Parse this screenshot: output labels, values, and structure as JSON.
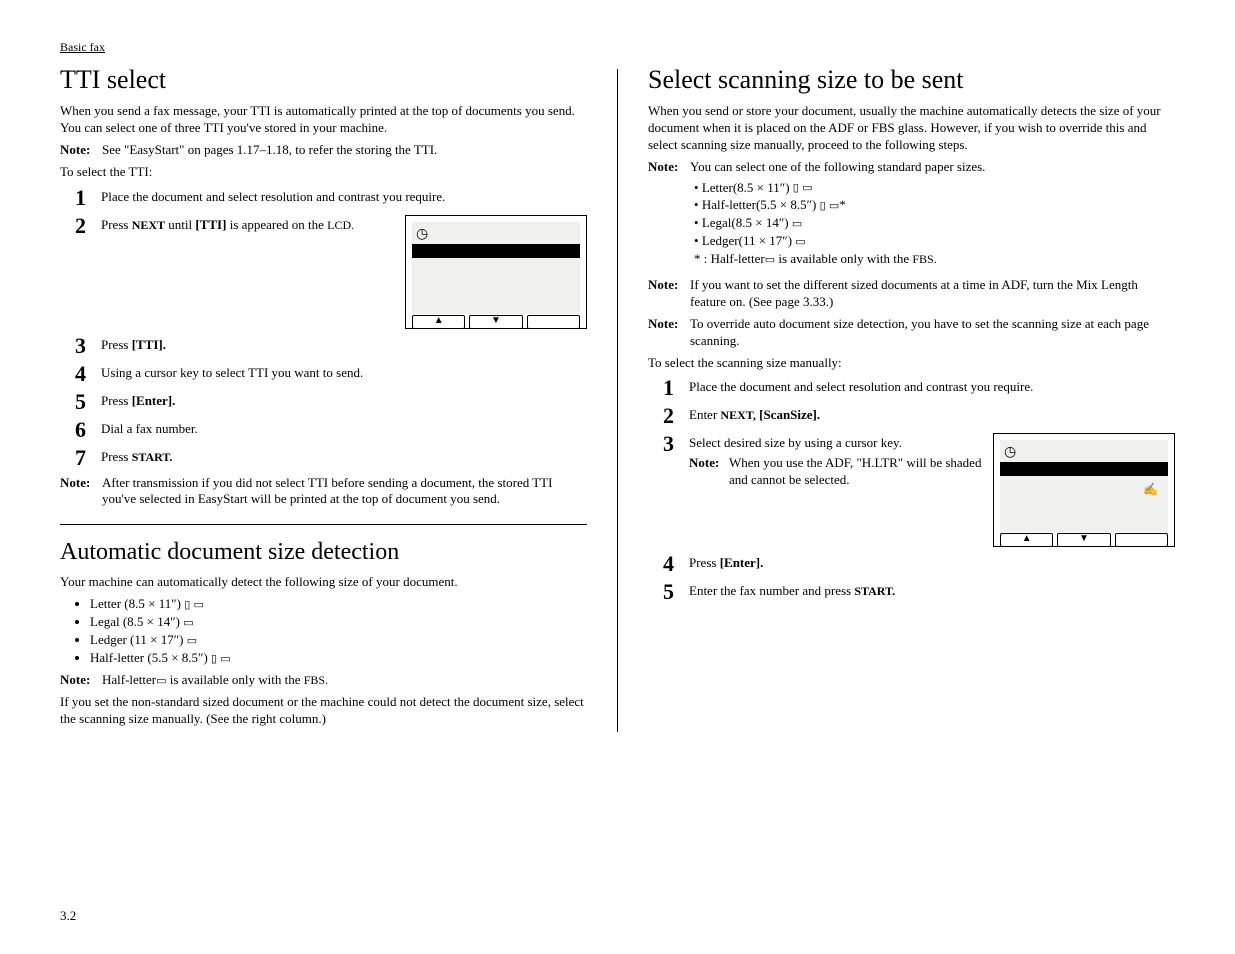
{
  "header": {
    "breadcrumb": "Basic fax"
  },
  "left": {
    "tti": {
      "title": "TTI select",
      "intro": "When you send a fax message, your TTI is automatically printed at the top of documents you send. You can select one of three TTI you've stored in your machine.",
      "note_storing_pre": "See \"EasyStart\" on pages 1.17–1.18, to refer the storing the TTI.",
      "lead": "To select the TTI:",
      "steps": {
        "s1": "Place the document and select resolution and contrast you require.",
        "s2a": "Press ",
        "s2b": " until ",
        "s2c": " is appeared on the ",
        "s3a": "Press ",
        "s4": "Using a cursor key to select TTI you want to send.",
        "s5a": "Press ",
        "s6": "Dial a fax number.",
        "s7a": "Press "
      },
      "note_after": "After transmission if you did not select TTI before sending a document, the stored TTI you've selected in EasyStart will be printed at the top of document you send."
    },
    "auto": {
      "title": "Automatic document size detection",
      "intro": "Your machine can automatically detect the following size of your document.",
      "sizes": {
        "letter": "Letter (8.5 × 11″)",
        "legal": "Legal (8.5 × 14″)",
        "ledger": "Ledger (11 × 17″)",
        "half": "Half-letter (5.5 × 8.5″)"
      },
      "note_half_pre": "Half-letter",
      "note_half_post": " is available only with the ",
      "nonstd": "If you set the non-standard sized document or the machine could not detect the document size, select the scanning size manually. (See the right column.)"
    }
  },
  "right": {
    "scan": {
      "title": "Select scanning size to be sent",
      "intro": "When you send or store your document, usually the machine automatically detects the size of your document when it is placed on the ADF or FBS glass. However, if you wish to override this and select scanning size manually, proceed to the following steps.",
      "note1_lead": "You can select one of the following standard paper sizes.",
      "sizes": {
        "letter": "Letter(8.5 × 11″)",
        "half": "Half-letter(5.5 × 8.5″)",
        "legal": "Legal(8.5 × 14″)",
        "ledger": "Ledger(11 × 17″)"
      },
      "asterisk_pre": "* :  Half-letter",
      "asterisk_post": " is available only with the ",
      "note2": "If you want to set the different sized documents at a time in ADF, turn the Mix Length feature on. (See page 3.33.)",
      "note3": "To override auto document size detection, you have to set the scanning size at each page scanning.",
      "lead": "To select the scanning size manually:",
      "steps": {
        "s1": "Place the document and select resolution and contrast you require.",
        "s2a": "Enter ",
        "s3": "Select desired size by using a cursor key.",
        "s3note": "When you use the ADF, \"H.LTR\" will be shaded and cannot be selected.",
        "s4a": "Press ",
        "s5a": "Enter the fax number and press "
      }
    }
  },
  "labels": {
    "note": "Note:",
    "next": "NEXT",
    "next_comma": "NEXT,",
    "tti_btn": "[TTI]",
    "tti_dot": "[TTI].",
    "lcd": "LCD.",
    "enter": "[Enter].",
    "start": "START.",
    "fbs": "FBS.",
    "scansize": " [ScanSize].",
    "page": "3.2"
  },
  "icons": {
    "portrait": "▯",
    "landscape": "▭",
    "up": "▲",
    "down": "▼",
    "clock": "◷",
    "hand": "✍"
  }
}
